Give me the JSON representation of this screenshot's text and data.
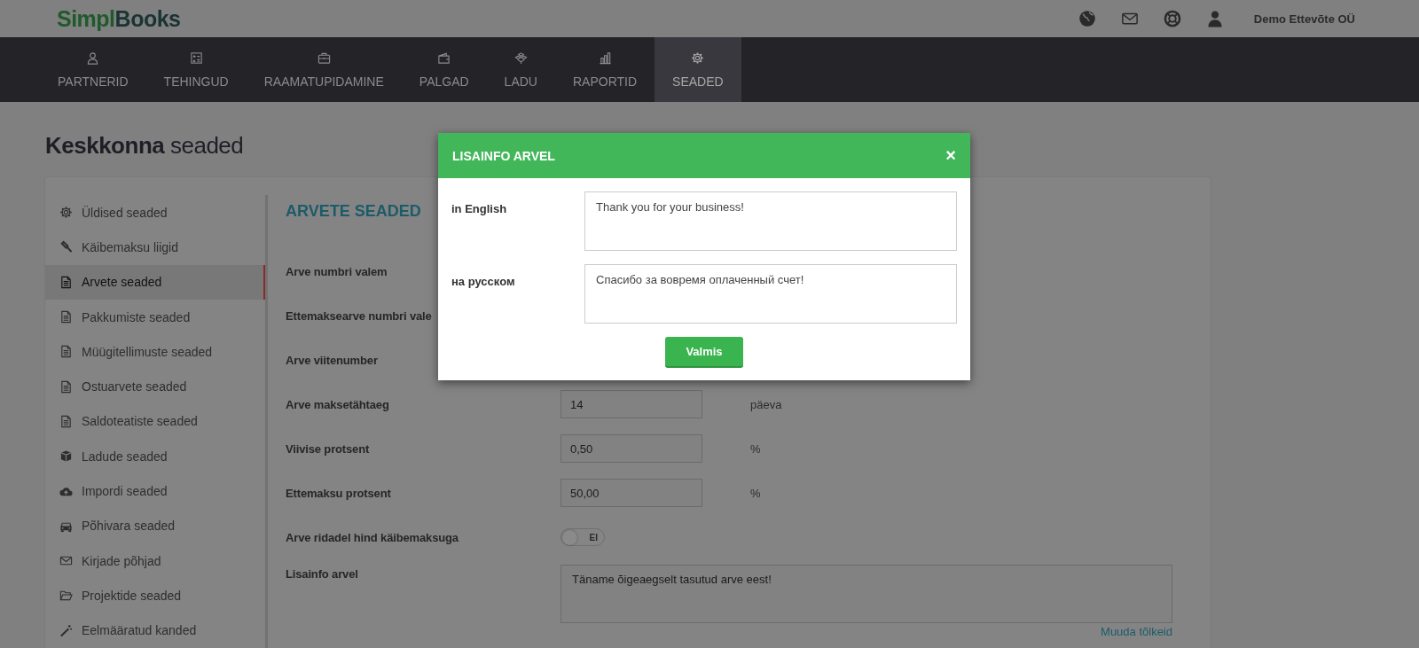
{
  "header": {
    "logo": {
      "first": "Simpl",
      "second": "Books"
    },
    "company": "Demo Ettevõte OÜ"
  },
  "nav": [
    {
      "label": "PARTNERID",
      "selected": false
    },
    {
      "label": "TEHINGUD",
      "selected": false
    },
    {
      "label": "RAAMATUPIDAMINE",
      "selected": false
    },
    {
      "label": "PALGAD",
      "selected": false
    },
    {
      "label": "LADU",
      "selected": false
    },
    {
      "label": "RAPORTID",
      "selected": false
    },
    {
      "label": "SEADED",
      "selected": true
    }
  ],
  "page_title": {
    "bold": "Keskkonna",
    "rest": "seaded"
  },
  "sidebar": [
    {
      "label": "Üldised seaded",
      "selected": false
    },
    {
      "label": "Käibemaksu liigid",
      "selected": false
    },
    {
      "label": "Arvete seaded",
      "selected": true
    },
    {
      "label": "Pakkumiste seaded",
      "selected": false
    },
    {
      "label": "Müügitellimuste seaded",
      "selected": false
    },
    {
      "label": "Ostuarvete seaded",
      "selected": false
    },
    {
      "label": "Saldoteatiste seaded",
      "selected": false
    },
    {
      "label": "Ladude seaded",
      "selected": false
    },
    {
      "label": "Impordi seaded",
      "selected": false
    },
    {
      "label": "Põhivara seaded",
      "selected": false
    },
    {
      "label": "Kirjade põhjad",
      "selected": false
    },
    {
      "label": "Projektide seaded",
      "selected": false
    },
    {
      "label": "Eelmääratud kanded",
      "selected": false
    }
  ],
  "section_title": "ARVETE SEADED",
  "form": [
    {
      "kind": "label",
      "label": "Arve numbri valem"
    },
    {
      "kind": "label",
      "label": "Ettemaksearve numbri vale"
    },
    {
      "kind": "label",
      "label": "Arve viitenumber"
    },
    {
      "kind": "input",
      "label": "Arve maksetähtaeg",
      "value": "14",
      "unit": "päeva"
    },
    {
      "kind": "input",
      "label": "Viivise protsent",
      "value": "0,50",
      "unit": "%"
    },
    {
      "kind": "input",
      "label": "Ettemaksu protsent",
      "value": "50,00",
      "unit": "%"
    },
    {
      "kind": "toggle",
      "label": "Arve ridadel hind käibemaksuga",
      "on": false,
      "state_text": "EI"
    },
    {
      "kind": "textarea",
      "label": "Lisainfo arvel",
      "value": "Täname õigeaegselt tasutud arve eest!",
      "link": "Muuda tõlkeid"
    }
  ],
  "modal": {
    "title": "LISAINFO ARVEL",
    "close": "×",
    "rows": [
      {
        "label": "in English",
        "value": "Thank you for your business!"
      },
      {
        "label": "на русском",
        "value": "Спасибо за вовремя оплаченный счет!"
      }
    ],
    "button": "Valmis"
  }
}
